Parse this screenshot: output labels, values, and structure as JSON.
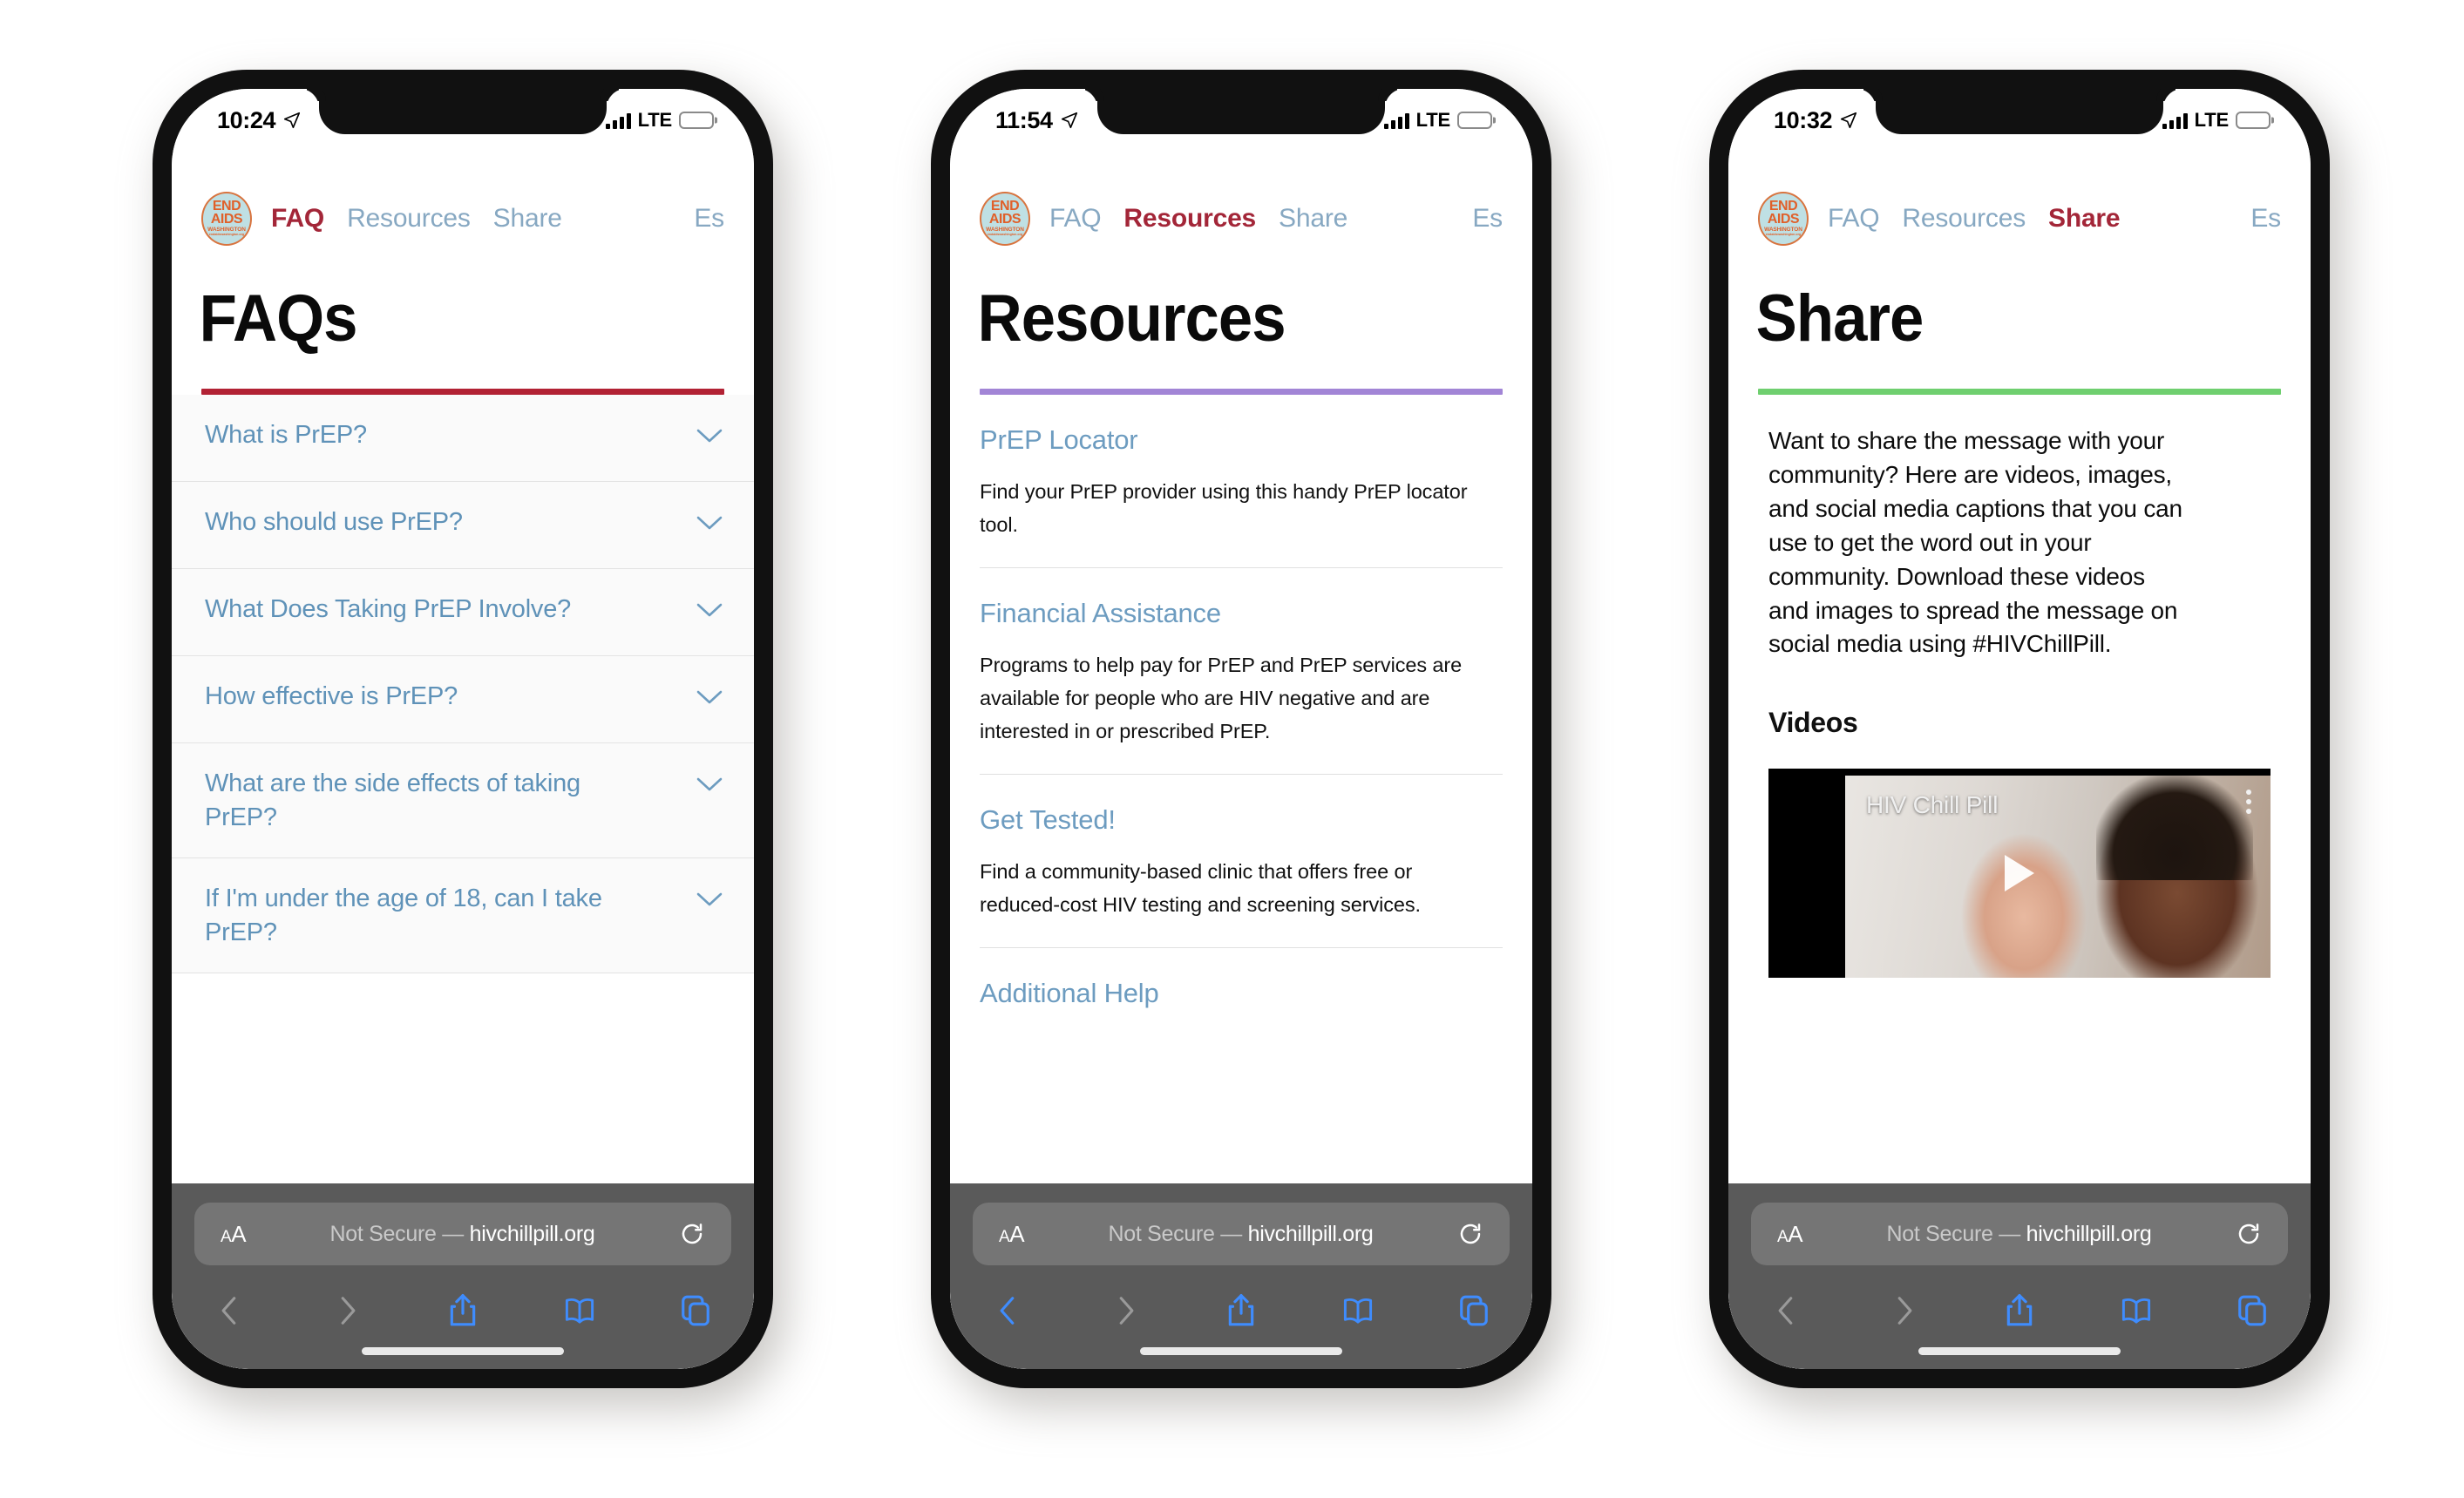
{
  "site": {
    "logo": {
      "line1": "END",
      "line2": "AIDS",
      "line3": "WASHINGTON",
      "line4": "endaidswashington.org"
    },
    "nav": {
      "faq": "FAQ",
      "resources": "Resources",
      "share": "Share",
      "lang": "Es"
    },
    "colors": {
      "nav_inactive": "#87a8c2",
      "nav_active": "#a32638",
      "faq_rule": "#b22234",
      "resources_rule": "#a285d6",
      "share_rule": "#6fcf6f",
      "heading": "#6d9cc0",
      "logo_bg": "#bfe0e4",
      "logo_ink": "#e0602a"
    }
  },
  "browser": {
    "aa_label": "AA",
    "url_not_secure": "Not Secure",
    "url_dash": "—",
    "url_domain": "hivchillpill.org",
    "icons": {
      "back": "chevron-left-icon",
      "forward": "chevron-right-icon",
      "share": "share-icon",
      "bookmarks": "book-icon",
      "tabs": "tabs-icon",
      "reload": "reload-icon"
    }
  },
  "phones": [
    {
      "status": {
        "time": "10:24",
        "location": "location-arrow-icon",
        "network": "LTE"
      },
      "active_nav": "FAQ",
      "page_title": "FAQs",
      "rule_color": "#b22234",
      "faq_items": [
        {
          "question": "What is PrEP?"
        },
        {
          "question": "Who should use PrEP?"
        },
        {
          "question": "What Does Taking PrEP Involve?"
        },
        {
          "question": "How effective is PrEP?"
        },
        {
          "question": "What are the side effects of taking PrEP?"
        },
        {
          "question": "If I'm under the age of 18, can I take PrEP?"
        }
      ]
    },
    {
      "status": {
        "time": "11:54",
        "location": "location-arrow-icon",
        "network": "LTE"
      },
      "active_nav": "Resources",
      "page_title": "Resources",
      "rule_color": "#a285d6",
      "resources": [
        {
          "title": "PrEP Locator",
          "description": "Find your PrEP provider using this handy PrEP locator tool."
        },
        {
          "title": "Financial Assistance",
          "description": "Programs to help pay for PrEP and PrEP services are available for people who are HIV negative and are interested in or prescribed PrEP."
        },
        {
          "title": "Get Tested!",
          "description": "Find a community-based clinic that offers free or reduced-cost HIV testing and screening services."
        },
        {
          "title": "Additional Help",
          "description": ""
        }
      ]
    },
    {
      "status": {
        "time": "10:32",
        "location": "location-arrow-icon",
        "network": "LTE"
      },
      "active_nav": "Share",
      "page_title": "Share",
      "rule_color": "#6fcf6f",
      "share": {
        "intro": "Want to share the message with your community? Here are videos, images, and social media captions that you can use to get the word out in your community. Download these videos and images to spread the message on social media using #HIVChillPill.",
        "videos_heading": "Videos",
        "video_title": "HIV Chill Pill"
      }
    }
  ]
}
